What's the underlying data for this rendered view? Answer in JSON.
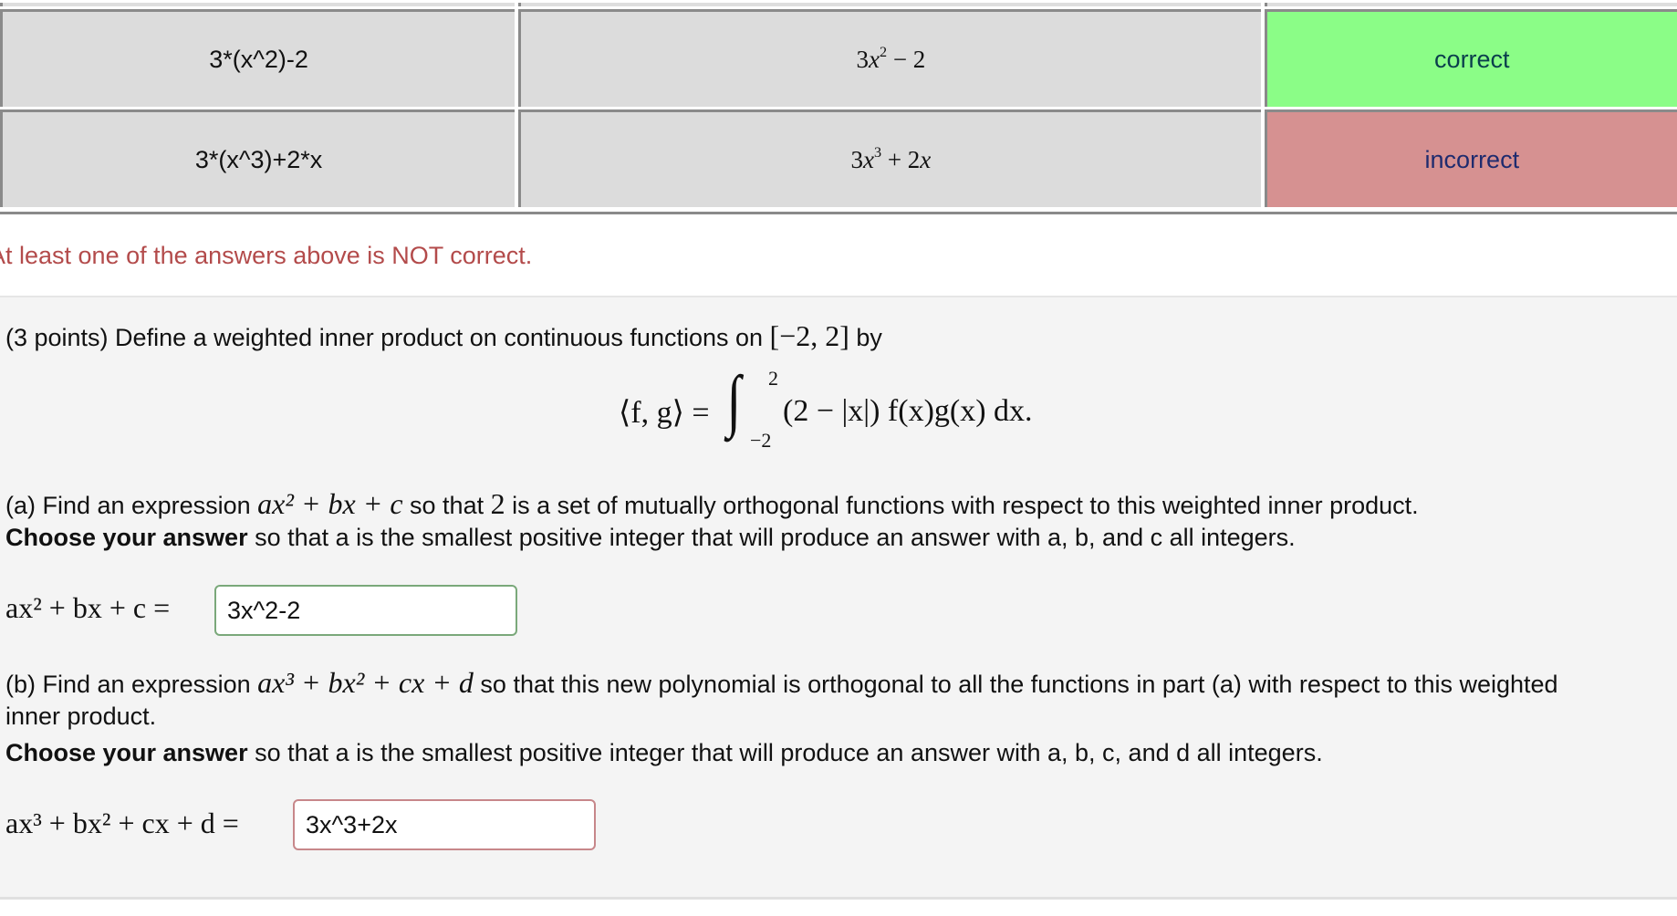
{
  "results_table": {
    "rows": [
      {
        "entered": "3*(x^2)-2",
        "preview": {
          "coef": "3",
          "var": "x",
          "exp": "2",
          "rest": " − 2"
        },
        "result": "correct",
        "status": "correct"
      },
      {
        "entered": "3*(x^3)+2*x",
        "preview": {
          "coef": "3",
          "var": "x",
          "exp": "3",
          "rest": " + 2",
          "rest_var": "x"
        },
        "result": "incorrect",
        "status": "incorrect"
      }
    ]
  },
  "warning_message": "At least one of the answers above is NOT correct.",
  "problem": {
    "intro": "(3 points) Define a weighted inner product on continuous functions on ",
    "interval": "[−2, 2]",
    "intro_end": " by",
    "formula": {
      "lhs": "⟨f, g⟩ =",
      "upper_limit": "2",
      "lower_limit": "−2",
      "integrand": "(2 − |x|) f(x)g(x) dx."
    },
    "part_a": {
      "text_1": "(a) Find an expression ",
      "expr": "ax² + bx + c",
      "text_2": " so that ",
      "num": "2",
      "text_3": " is a set of mutually orthogonal functions with respect to this weighted inner product.",
      "choose_bold": "Choose your answer",
      "choose_rest": " so that a is the smallest positive integer that will produce an answer with a, b, and c all integers.",
      "label": "ax² + bx + c =",
      "value": "3x^2-2",
      "status": "correct"
    },
    "part_b": {
      "text_1": "(b) Find an expression ",
      "expr": "ax³ + bx² + cx + d",
      "text_2": " so that this new polynomial is orthogonal to all the functions in part (a) with respect to this weighted",
      "text_3": "inner product.",
      "choose_bold": "Choose your answer",
      "choose_rest": " so that a is the smallest positive integer that will produce an answer with a, b, c, and d all integers.",
      "label": "ax³ + bx² + cx + d =",
      "value": "3x^3+2x",
      "status": "incorrect"
    }
  },
  "colors": {
    "correct_bg": "#8bfd87",
    "incorrect_bg": "#d69191",
    "warning_text": "#b34b4b",
    "input_correct_border": "#7aa87a",
    "input_incorrect_border": "#c7878a"
  }
}
